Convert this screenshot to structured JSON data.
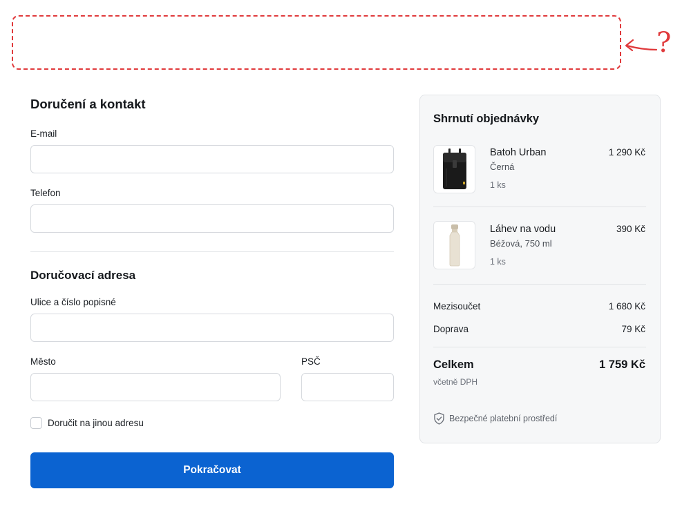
{
  "annotation": {
    "question_mark": "?",
    "color": "#e0393b"
  },
  "delivery": {
    "heading": "Doručení a kontakt",
    "email_label": "E-mail",
    "email_value": "",
    "phone_label": "Telefon",
    "phone_value": ""
  },
  "address": {
    "heading": "Doručovací adresa",
    "street_label": "Ulice a číslo popisné",
    "street_value": "",
    "city_label": "Město",
    "city_value": "",
    "zip_label": "PSČ",
    "zip_value": "",
    "alt_address_label": "Doručit na jinou adresu",
    "alt_address_checked": false
  },
  "continue_button": {
    "label": "Pokračovat",
    "color": "#0b63d1"
  },
  "summary": {
    "title": "Shrnutí objednávky",
    "items": [
      {
        "name": "Batoh Urban",
        "variant": "Černá",
        "qty": "1 ks",
        "price": "1 290 Kč",
        "icon": "backpack-icon"
      },
      {
        "name": "Láhev na vodu",
        "variant": "Béžová, 750 ml",
        "qty": "1 ks",
        "price": "390 Kč",
        "icon": "water-bottle-icon"
      }
    ],
    "subtotal_label": "Mezisoučet",
    "subtotal_value": "1 680 Kč",
    "shipping_label": "Doprava",
    "shipping_value": "79 Kč",
    "total_label": "Celkem",
    "total_value": "1 759 Kč",
    "vat_note": "včetně DPH",
    "secure_note": "Bezpečné platební prostředí",
    "secure_icon": "shield-check-icon"
  }
}
